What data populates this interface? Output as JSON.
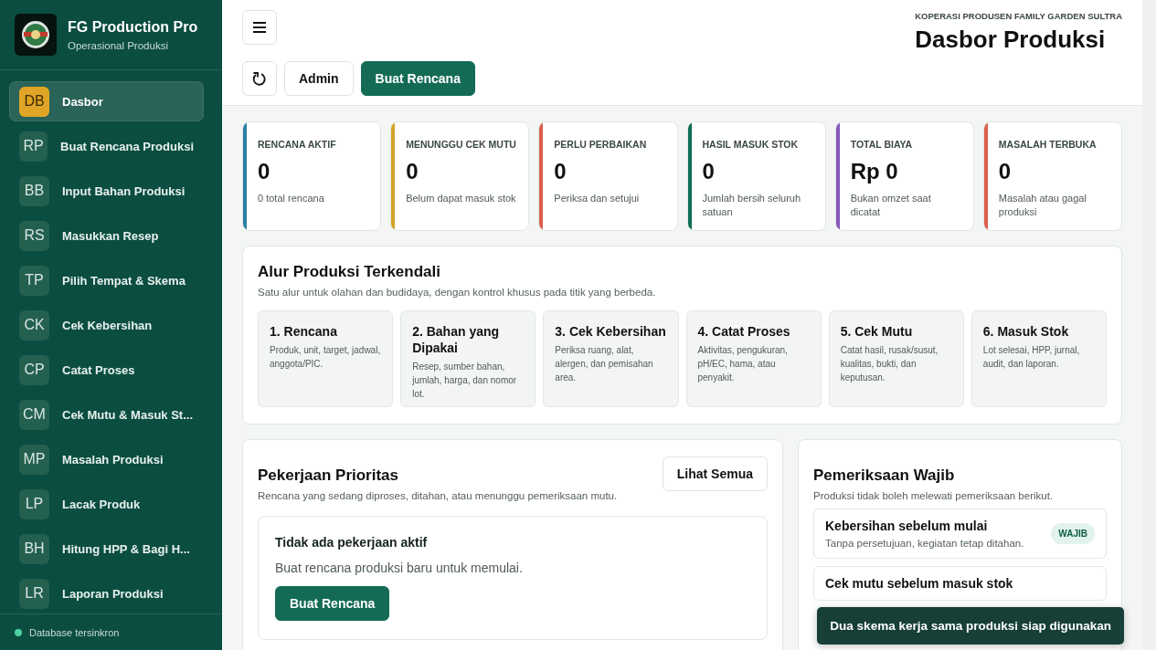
{
  "app": {
    "name": "FG Production Pro",
    "subtitle": "Operasional Produksi"
  },
  "sidebar": {
    "items": [
      {
        "code": "DB",
        "label": "Dasbor",
        "selected": true
      },
      {
        "code": "RP",
        "label": "Buat Rencana Produksi",
        "selected": false
      },
      {
        "code": "BB",
        "label": "Input Bahan Produksi",
        "selected": false
      },
      {
        "code": "RS",
        "label": "Masukkan Resep",
        "selected": false
      },
      {
        "code": "TP",
        "label": "Pilih Tempat & Skema",
        "selected": false
      },
      {
        "code": "CK",
        "label": "Cek Kebersihan",
        "selected": false
      },
      {
        "code": "CP",
        "label": "Catat Proses",
        "selected": false
      },
      {
        "code": "CM",
        "label": "Cek Mutu & Masuk St...",
        "selected": false
      },
      {
        "code": "MP",
        "label": "Masalah Produksi",
        "selected": false
      },
      {
        "code": "LP",
        "label": "Lacak Produk",
        "selected": false
      },
      {
        "code": "BH",
        "label": "Hitung HPP & Bagi H...",
        "selected": false
      },
      {
        "code": "LR",
        "label": "Laporan Produksi",
        "selected": false
      }
    ],
    "status": "Database tersinkron"
  },
  "header": {
    "org": "KOPERASI PRODUSEN FAMILY GARDEN SULTRA",
    "title": "Dasbor Produksi",
    "buttons": [
      {
        "kind": "outline",
        "label": "Admin"
      },
      {
        "kind": "primary",
        "label": "Buat Rencana"
      }
    ]
  },
  "stats": [
    {
      "label": "RENCANA AKTIF",
      "value": "0",
      "note": "0 total rencana",
      "color": "#2b7fa6"
    },
    {
      "label": "MENUNGGU CEK MUTU",
      "value": "0",
      "note": "Belum dapat masuk stok",
      "color": "#d6a22a"
    },
    {
      "label": "PERLU PERBAIKAN",
      "value": "0",
      "note": "Periksa dan setujui",
      "color": "#d9604c"
    },
    {
      "label": "HASIL MASUK STOK",
      "value": "0",
      "note": "Jumlah bersih seluruh satuan",
      "color": "#0f6b55"
    },
    {
      "label": "TOTAL BIAYA",
      "value": "Rp 0",
      "note": "Bukan omzet saat dicatat",
      "color": "#8657b8"
    },
    {
      "label": "MASALAH TERBUKA",
      "value": "0",
      "note": "Masalah atau gagal produksi",
      "color": "#d9604c"
    }
  ],
  "flow": {
    "title": "Alur Produksi Terkendali",
    "subtitle": "Satu alur untuk olahan dan budidaya, dengan kontrol khusus pada titik yang berbeda.",
    "steps": [
      {
        "title": "1. Rencana",
        "text": "Produk, unit, target, jadwal, anggota/PIC."
      },
      {
        "title": "2. Bahan yang Dipakai",
        "text": "Resep, sumber bahan, jumlah, harga, dan nomor lot."
      },
      {
        "title": "3. Cek Kebersihan",
        "text": "Periksa ruang, alat, alergen, dan pemisahan area."
      },
      {
        "title": "4. Catat Proses",
        "text": "Aktivitas, pengukuran, pH/EC, hama, atau penyakit."
      },
      {
        "title": "5. Cek Mutu",
        "text": "Catat hasil, rusak/susut, kualitas, bukti, dan keputusan."
      },
      {
        "title": "6. Masuk Stok",
        "text": "Lot selesai, HPP, jurnal, audit, dan laporan."
      }
    ]
  },
  "priority": {
    "title": "Pekerjaan Prioritas",
    "subtitle": "Rencana yang sedang diproses, ditahan, atau menunggu pemeriksaan mutu.",
    "link": "Lihat Semua",
    "empty": {
      "title": "Tidak ada pekerjaan aktif",
      "text": "Buat rencana produksi baru untuk memulai.",
      "button": "Buat Rencana"
    }
  },
  "checks": {
    "title": "Pemeriksaan Wajib",
    "subtitle": "Produksi tidak boleh melewati pemeriksaan berikut.",
    "items": [
      {
        "title": "Kebersihan sebelum mulai",
        "text": "Tanpa persetujuan, kegiatan tetap ditahan.",
        "badge": "WAJIB"
      },
      {
        "title": "Cek mutu sebelum masuk stok"
      }
    ]
  },
  "toast": "Dua skema kerja sama produksi siap digunakan"
}
